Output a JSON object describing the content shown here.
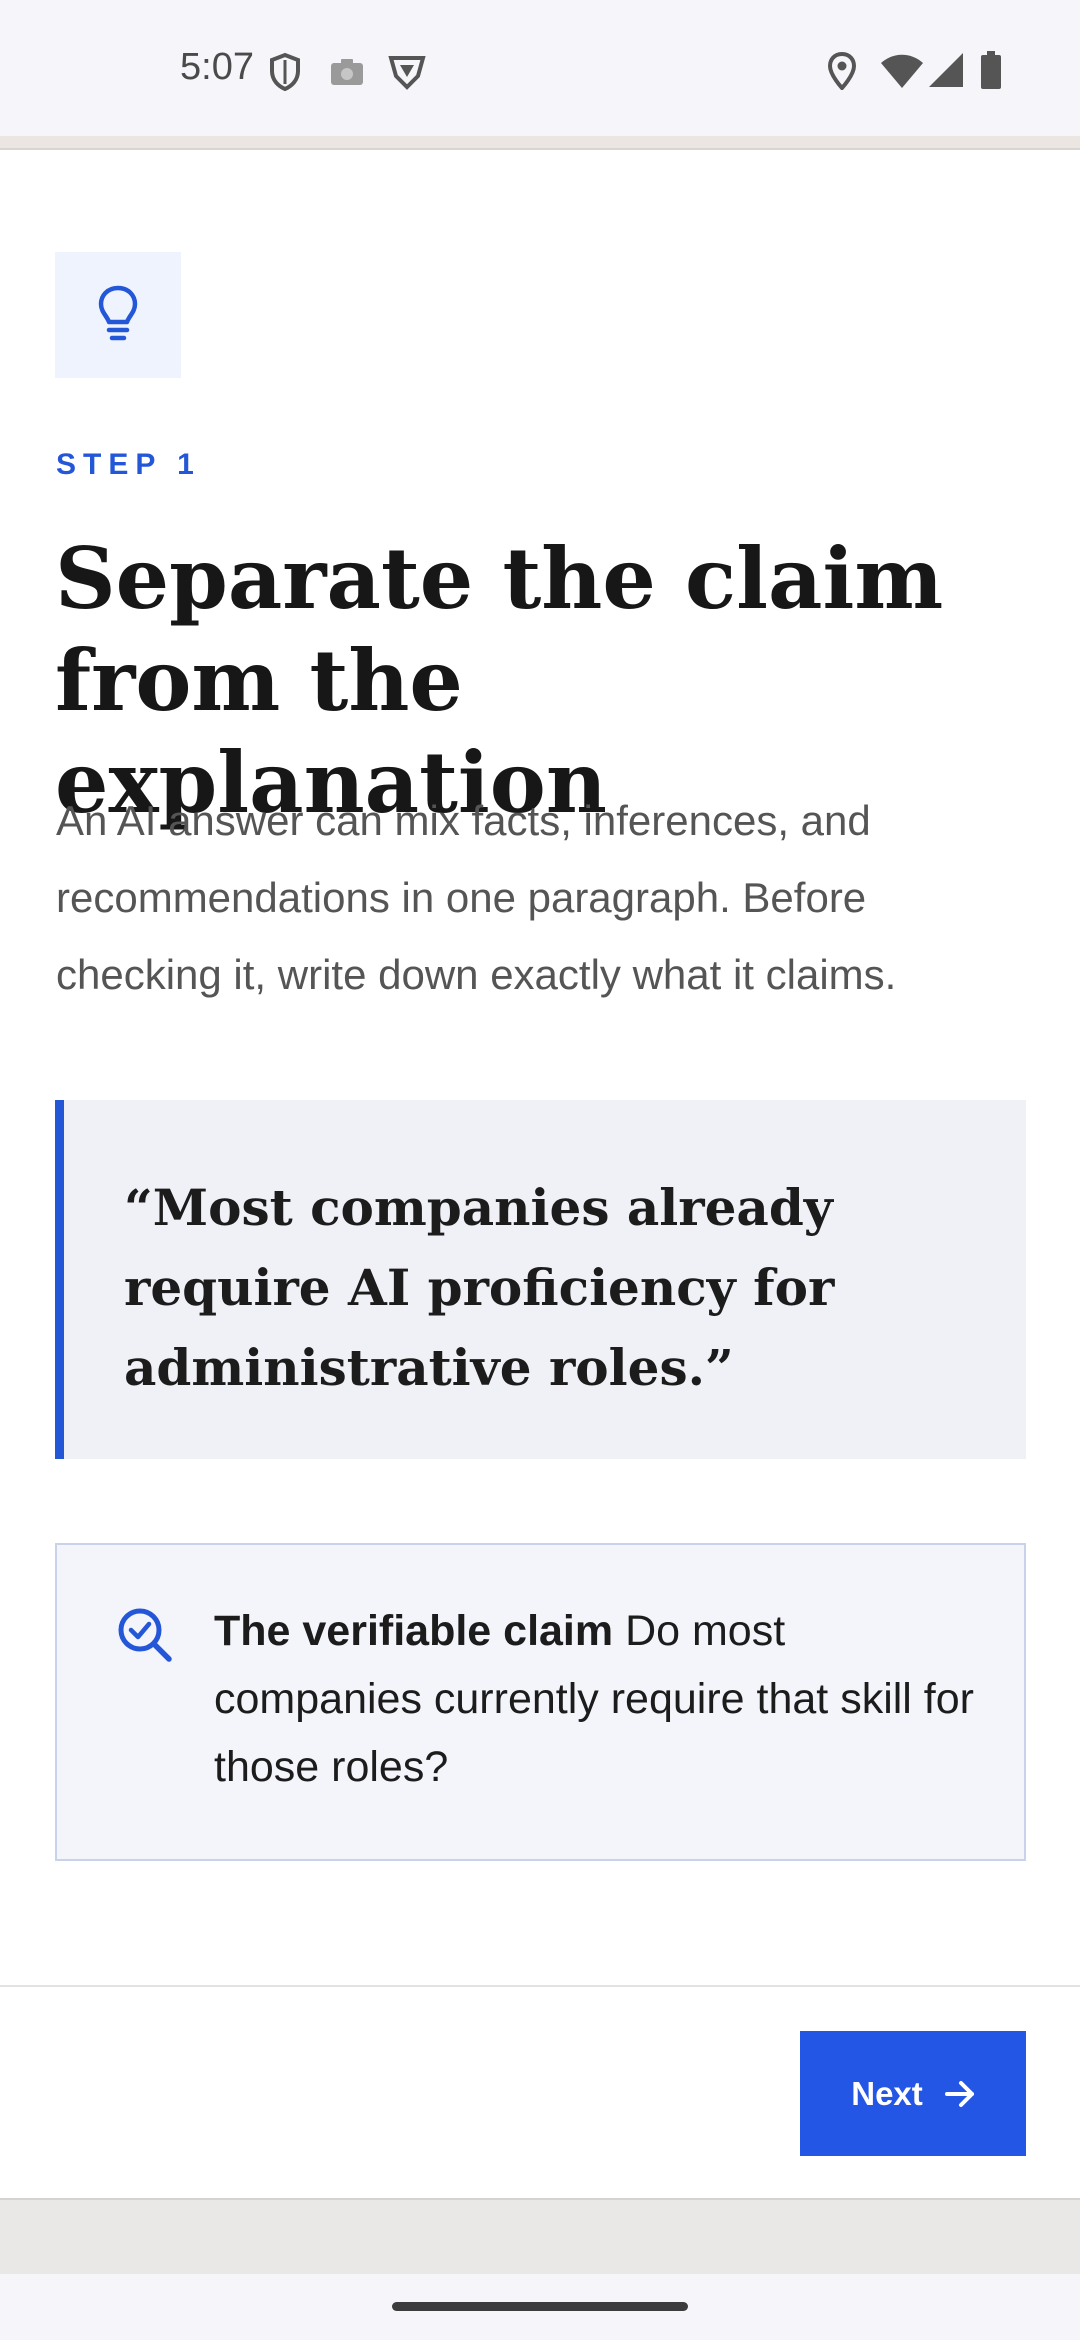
{
  "status_bar": {
    "time": "5:07"
  },
  "icons": {
    "shield": "shield-icon",
    "camera": "camera-icon",
    "vpn": "vpn-shield-icon",
    "location": "location-icon",
    "wifi": "wifi-icon",
    "signal": "signal-icon",
    "battery": "battery-icon",
    "lightbulb": "lightbulb-icon",
    "search_check": "search-check-icon",
    "arrow_right": "arrow-right-icon"
  },
  "colors": {
    "accent": "#2456d8",
    "button": "#2456e6",
    "quote_bg": "#f0f1f6",
    "claim_bg": "#f4f5fb"
  },
  "main": {
    "step_label": "STEP 1",
    "title": "Separate the claim from the explanation",
    "intro": "An AI answer can mix facts, inferences, and recommendations in one paragraph. Before checking it, write down exactly what it claims.",
    "quote": "“Most companies already require AI proficiency for administrative roles.”",
    "claim_label": "The verifiable claim",
    "claim_text": "Do most companies currently require that skill for those roles?"
  },
  "footer": {
    "next_label": "Next"
  }
}
